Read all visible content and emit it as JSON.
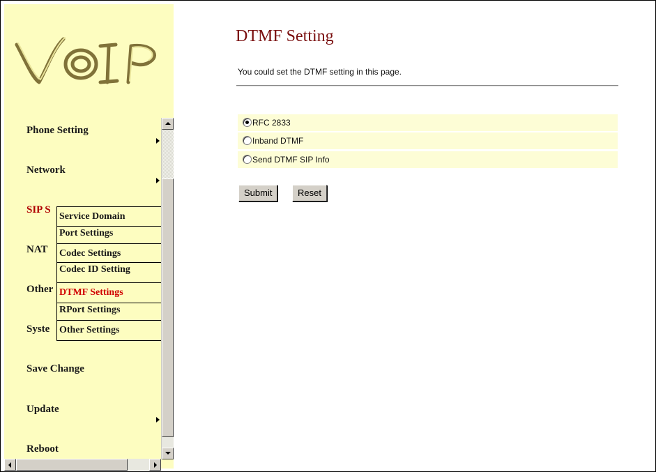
{
  "sidebar": {
    "logo_text": "VoIP",
    "items": [
      {
        "label": "Phone Setting",
        "has_arrow": true
      },
      {
        "label": "Network",
        "has_arrow": true
      },
      {
        "label": "SIP Setting",
        "visible_label": "SIP S"
      },
      {
        "label": "NAT",
        "visible_label": "NAT"
      },
      {
        "label": "Other",
        "visible_label": "Other"
      },
      {
        "label": "System",
        "visible_label": "Syste"
      },
      {
        "label": "Save Change"
      },
      {
        "label": "Update",
        "has_arrow": true
      },
      {
        "label": "Reboot"
      }
    ],
    "submenu": [
      {
        "label": "Service Domain"
      },
      {
        "label": "Port Settings"
      },
      {
        "label": "Codec Settings"
      },
      {
        "label": "Codec ID Setting"
      },
      {
        "label": "DTMF Settings",
        "active": true
      },
      {
        "label": "RPort Settings"
      },
      {
        "label": "Other Settings"
      }
    ]
  },
  "main": {
    "title": "DTMF Setting",
    "description": "You could set the DTMF setting in this page.",
    "options": [
      {
        "label": "RFC 2833",
        "checked": true
      },
      {
        "label": "Inband DTMF",
        "checked": false
      },
      {
        "label": "Send DTMF SIP Info",
        "checked": false
      }
    ],
    "submit_label": "Submit",
    "reset_label": "Reset"
  },
  "colors": {
    "sidebar_bg": "#fdfdc0",
    "title": "#7a0f0f",
    "active_item": "#d00000",
    "option_row_bg": "#fdfdd6"
  }
}
